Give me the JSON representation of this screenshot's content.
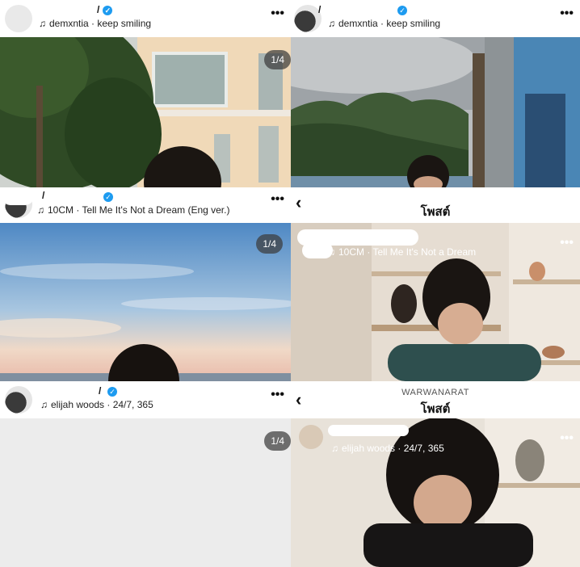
{
  "panels": [
    {
      "username": "/",
      "music_note": "♫",
      "music": "demxntia · keep smiling",
      "more": "•••",
      "counter": "1/4"
    },
    {
      "username": "/",
      "music_note": "♫",
      "music": "demxntia · keep smiling",
      "more": "•••"
    },
    {
      "username": "/",
      "music_note": "♫",
      "music": "10CM · Tell Me It's Not a Dream (Eng ver.)",
      "more": "•••",
      "counter": "1/4"
    },
    {
      "back": "‹",
      "title": "โพสต์",
      "music_note": "♫",
      "music": "10CM · Tell Me It's Not a Dream",
      "more": "•••"
    },
    {
      "username": "/",
      "music_note": "♫",
      "music": "elijah woods · 24/7, 365",
      "more": "•••",
      "counter": "1/4"
    },
    {
      "back": "‹",
      "account": "WARWANARAT",
      "title": "โพสต์",
      "music_note": "♫",
      "music": "elijah woods · 24/7, 365",
      "more": "•••"
    }
  ],
  "icons": {
    "verified": "✓"
  },
  "colors": {
    "verified": "#1d9bf0",
    "badge": "#3c3c3c"
  }
}
